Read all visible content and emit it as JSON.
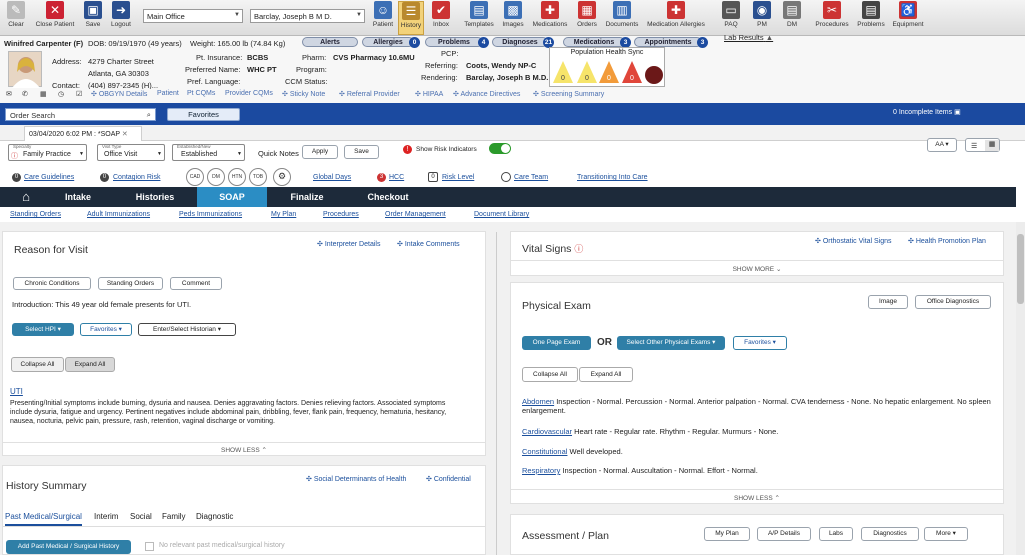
{
  "toolbar": {
    "left": [
      "Clear",
      "Close Patient",
      "Save",
      "Logout"
    ],
    "facility": "Main Office",
    "provider": "Barclay, Joseph B M D.",
    "right": [
      "Patient",
      "History",
      "Inbox",
      "Templates",
      "Images",
      "Medications",
      "Orders",
      "Documents",
      "Medication Allergies",
      "PAQ",
      "PM",
      "DM",
      "Procedures",
      "Problems",
      "Equipment"
    ]
  },
  "patient": {
    "name": "Winifred Carpenter",
    "sex": "(F)",
    "dob": "DOB: 09/19/1970 (49 years)",
    "weight": "Weight: 165.00 lb (74.84 Kg)",
    "address_label": "Address:",
    "address1": "4279 Charter Street",
    "address2": "Atlanta, GA 30303",
    "contact_label": "Contact:",
    "contact": "(404) 897-2345 (H)...",
    "insurance_label": "Pt. Insurance:",
    "insurance": "BCBS",
    "preferred_label": "Preferred Name:",
    "preferred": "WHC PT",
    "language_label": "Pref. Language:",
    "pharm_label": "Pharm:",
    "pharm": "CVS Pharmacy 10.6MU",
    "program_label": "Program:",
    "ccm_label": "CCM Status:",
    "pcp_label": "PCP:",
    "referring_label": "Referring:",
    "referring": "Coots, Wendy NP-C",
    "rendering_label": "Rendering:",
    "rendering": "Barclay, Joseph B M.D.",
    "pills": [
      {
        "label": "Alerts",
        "count": ""
      },
      {
        "label": "Allergies",
        "count": "0"
      },
      {
        "label": "Problems",
        "count": "4"
      },
      {
        "label": "Diagnoses",
        "count": "21"
      },
      {
        "label": "Medications",
        "count": "3"
      },
      {
        "label": "Appointments",
        "count": "3"
      }
    ],
    "lab_results": "Lab Results",
    "phs_title": "Population Health Sync",
    "phs_values": [
      "0",
      "0",
      "0",
      "0"
    ],
    "links": [
      "OBGYN Details",
      "Patient",
      "Pt CQMs",
      "Provider CQMs",
      "Sticky Note",
      "Referral Provider",
      "HIPAA",
      "Advance Directives",
      "Screening Summary"
    ]
  },
  "bluebar": {
    "search": "Order Search",
    "favorites": "Favorites",
    "incomplete": "0 Incomplete Items"
  },
  "tab": "03/04/2020 6:02 PM : *SOAP",
  "controls": {
    "specialty_label": "Specialty",
    "specialty": "Family Practice",
    "visit_label": "Visit Type",
    "visit": "Office Visit",
    "est_label": "Established/New",
    "est": "Established",
    "quick_notes": "Quick Notes",
    "apply": "Apply",
    "save": "Save",
    "risk": "Show Risk Indicators",
    "aa": "AA"
  },
  "guides": {
    "care": "Care Guidelines",
    "contagion": "Contagion Risk",
    "circles": [
      "CAD",
      "DM",
      "HTN",
      "TOB"
    ],
    "global_days": "Global Days",
    "hcc": "HCC",
    "risk_level": "Risk Level",
    "care_team": "Care Team",
    "transition": "Transitioning Into Care",
    "hcc_count": "3",
    "care_count": "0",
    "contagion_count": "0",
    "risk_count": "0"
  },
  "nav": [
    "Intake",
    "Histories",
    "SOAP",
    "Finalize",
    "Checkout"
  ],
  "subnav": [
    "Standing Orders",
    "Adult Immunizations",
    "Peds Immunizations",
    "My Plan",
    "Procedures",
    "Order Management",
    "Document Library"
  ],
  "reason": {
    "title": "Reason for Visit",
    "interpreter": "Interpreter Details",
    "intake": "Intake Comments",
    "buttons": [
      "Chronic Conditions",
      "Standing Orders",
      "Comment"
    ],
    "intro": "Introduction: This 49 year old female presents for UTI.",
    "select_hpi": "Select HPI",
    "favorites": "Favorites",
    "historian": "Enter/Select Historian",
    "collapse": "Collapse All",
    "expand": "Expand All",
    "uti": "UTI",
    "uti_text": "Presenting/Initial symptoms include burning, dysuria and nausea.  Denies aggravating factors.  Denies relieving factors.  Associated symptoms include dysuria, fatigue and urgency.  Pertinent negatives include abdominal pain, dribbling, fever, flank pain, frequency, hematuria, hesitancy, nausea, nocturia, pelvic pain, pressure, rash, retention, vaginal discharge or vomiting.",
    "show_less": "SHOW LESS"
  },
  "history": {
    "title": "History Summary",
    "sdoh": "Social Determinants of Health",
    "confidential": "Confidential",
    "tabs": [
      "Past Medical/Surgical",
      "Interim",
      "Social",
      "Family",
      "Diagnostic"
    ],
    "add": "Add Past Medical / Surgical History",
    "no_relevant": "No relevant past medical/surgical history"
  },
  "vitals": {
    "title": "Vital Signs",
    "orthostatic": "Orthostatic Vital Signs",
    "promo": "Health Promotion Plan",
    "show_more": "SHOW MORE"
  },
  "exam": {
    "title": "Physical Exam",
    "image": "Image",
    "office": "Office Diagnostics",
    "one_page": "One Page Exam",
    "or": "OR",
    "select_other": "Select Other Physical Exams",
    "favorites": "Favorites",
    "collapse": "Collapse All",
    "expand": "Expand All",
    "items": [
      {
        "label": "Abdomen",
        "text": "Inspection - Normal. Percussion - Normal. Anterior palpation - Normal. CVA tenderness - None. No hepatic enlargement. No spleen enlargement."
      },
      {
        "label": "Cardiovascular",
        "text": "Heart rate - Regular rate. Rhythm - Regular. Murmurs - None."
      },
      {
        "label": "Constitutional",
        "text": "Well developed."
      },
      {
        "label": "Respiratory",
        "text": "Inspection - Normal. Auscultation - Normal. Effort - Normal."
      }
    ],
    "show_less": "SHOW LESS"
  },
  "assessment": {
    "title": "Assessment / Plan",
    "buttons": [
      "My Plan",
      "A/P Details",
      "Labs",
      "Diagnostics",
      "More"
    ]
  }
}
